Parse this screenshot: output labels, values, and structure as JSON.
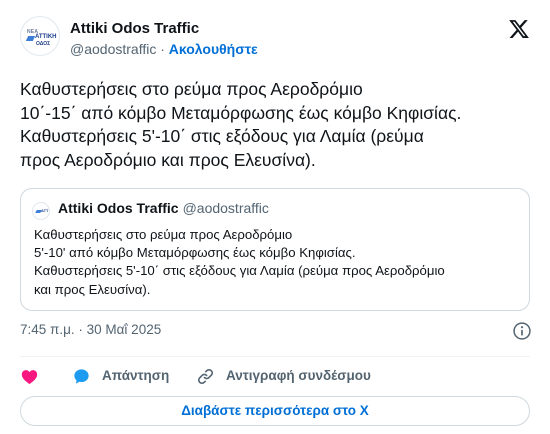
{
  "author": {
    "name": "Attiki Odos Traffic",
    "handle": "@aodostraffic",
    "separator": "·",
    "follow_label": "Ακολουθήστε",
    "avatar_text": {
      "l1": "ΝΕΑ",
      "l2": "ΑΤΤΙΚΗ",
      "l3": "ΟΔΟΣ"
    }
  },
  "tweet": {
    "lines": [
      "Καθυστερήσεις στο ρεύμα προς Αεροδρόμιο",
      "10΄-15΄ από κόμβο Μεταμόρφωσης έως κόμβο Κηφισίας.",
      "Καθυστερήσεις 5'-10΄ στις εξόδους για Λαμία (ρεύμα",
      "προς Αεροδρόμιο και προς Ελευσίνα)."
    ]
  },
  "quote": {
    "name": "Attiki Odos Traffic",
    "handle": "@aodostraffic",
    "avatar_text": "ATT",
    "lines": [
      "Καθυστερήσεις στο ρεύμα προς Αεροδρόμιο",
      "5'-10' από κόμβο Μεταμόρφωσης έως κόμβο Κηφισίας.",
      "Καθυστερήσεις 5'-10΄ στις εξόδους για Λαμία (ρεύμα προς Αεροδρόμιο",
      "και προς Ελευσίνα)."
    ]
  },
  "meta": {
    "timestamp": "7:45 π.μ. · 30 Μαΐ 2025"
  },
  "actions": {
    "reply_label": "Απάντηση",
    "copy_link_label": "Αντιγραφή συνδέσμου"
  },
  "read_more_label": "Διαβάστε περισσότερα στο X",
  "icons": {
    "like": "heart-icon",
    "reply": "reply-bubble-icon",
    "copy": "link-icon",
    "info": "info-icon",
    "brand": "x-logo-icon"
  },
  "colors": {
    "accent": "#006fd6",
    "like": "#f91880",
    "reply": "#1d9bf0",
    "muted": "#536471",
    "text": "#0f1419"
  }
}
